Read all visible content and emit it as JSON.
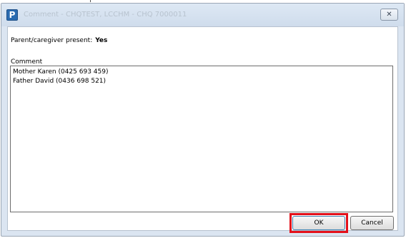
{
  "window": {
    "title": "Comment - CHQTEST, LCCHM - CHQ 7000011",
    "app_icon_letter": "P",
    "close_symbol": "✕"
  },
  "form": {
    "parent_label": "Parent/caregiver present:",
    "parent_value": "Yes",
    "comment_label": "Comment",
    "comment_lines": [
      "Mother Karen (0425 693 459)",
      "Father David (0436 698 521)"
    ]
  },
  "buttons": {
    "ok_label": "OK",
    "cancel_label": "Cancel"
  },
  "colors": {
    "highlight": "#e3101a",
    "titlebar": "#dbe5f1"
  }
}
